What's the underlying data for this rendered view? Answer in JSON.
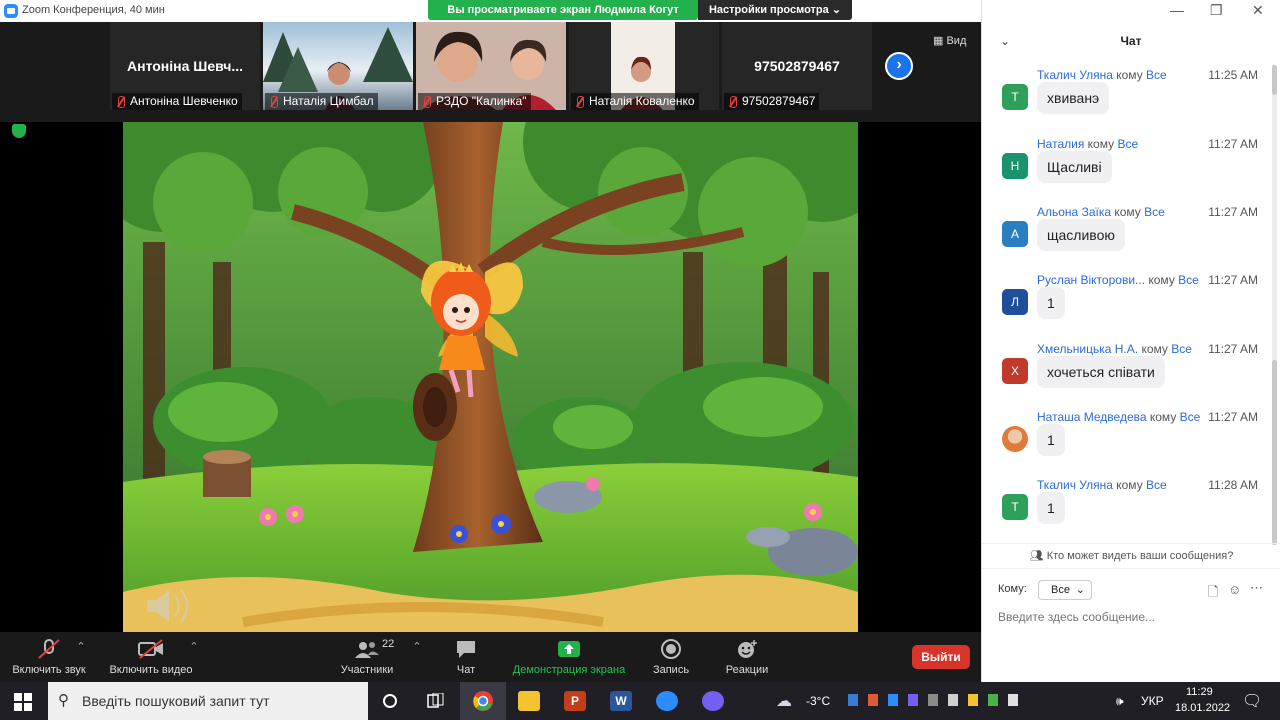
{
  "window": {
    "title": "Zoom Конференция, 40 мин"
  },
  "banner": {
    "viewing": "Вы просматриваете экран Людмила Когут",
    "view_options": "Настройки просмотра"
  },
  "thumbnails": [
    {
      "big": "Антоніна Шевч...",
      "label": "Антоніна Шевченко"
    },
    {
      "big": "",
      "label": "Наталія Цимбал"
    },
    {
      "big": "",
      "label": "РЗДО \"Калинка\""
    },
    {
      "big": "",
      "label": "Наталія Коваленко"
    },
    {
      "big": "97502879467",
      "label": "97502879467"
    }
  ],
  "view_toggle": "Вид",
  "toolbar": {
    "mute": "Включить звук",
    "video": "Включить видео",
    "participants": "Участники",
    "participants_count": "22",
    "chat": "Чат",
    "share": "Демонстрация экрана",
    "record": "Запись",
    "reactions": "Реакции",
    "leave": "Выйти"
  },
  "chat": {
    "title": "Чат",
    "messages": [
      {
        "from": "Ткалич Уляна",
        "to_word": "кому",
        "to": "Все",
        "time": "11:25 AM",
        "text": "хвиванэ",
        "avatar": "Т",
        "color": "#2ea05a"
      },
      {
        "from": "Наталия",
        "to_word": "кому",
        "to": "Все",
        "time": "11:27 AM",
        "text": "Щасливі",
        "avatar": "Н",
        "color": "#19926e"
      },
      {
        "from": "Альона Заїка",
        "to_word": "кому",
        "to": "Все",
        "time": "11:27 AM",
        "text": "щасливою",
        "avatar": "А",
        "color": "#2a7fc0"
      },
      {
        "from": "Руслан Вікторови...",
        "to_word": "кому",
        "to": "Все",
        "time": "11:27 AM",
        "text": "1",
        "avatar": "Л",
        "color": "#1f4e9a"
      },
      {
        "from": "Хмельницька Н.А.",
        "to_word": "кому",
        "to": "Все",
        "time": "11:27 AM",
        "text": "хочеться співати",
        "avatar": "Х",
        "color": "#c0392b"
      },
      {
        "from": "Наташа Медведева",
        "to_word": "кому",
        "to": "Все",
        "time": "11:27 AM",
        "text": "1",
        "avatar": "",
        "color": "#e07a3a"
      },
      {
        "from": "Ткалич Уляна",
        "to_word": "кому",
        "to": "Все",
        "time": "11:28 AM",
        "text": "1",
        "avatar": "Т",
        "color": "#2ea05a"
      }
    ],
    "who_can_see": "Кто может видеть ваши сообщения?",
    "to_label": "Кому:",
    "to_value": "Все",
    "input_placeholder": "Введите здесь сообщение..."
  },
  "taskbar": {
    "search_placeholder": "Введіть пошуковий запит тут",
    "weather": "-3°C",
    "lang": "УКР",
    "time": "11:29",
    "date": "18.01.2022"
  }
}
